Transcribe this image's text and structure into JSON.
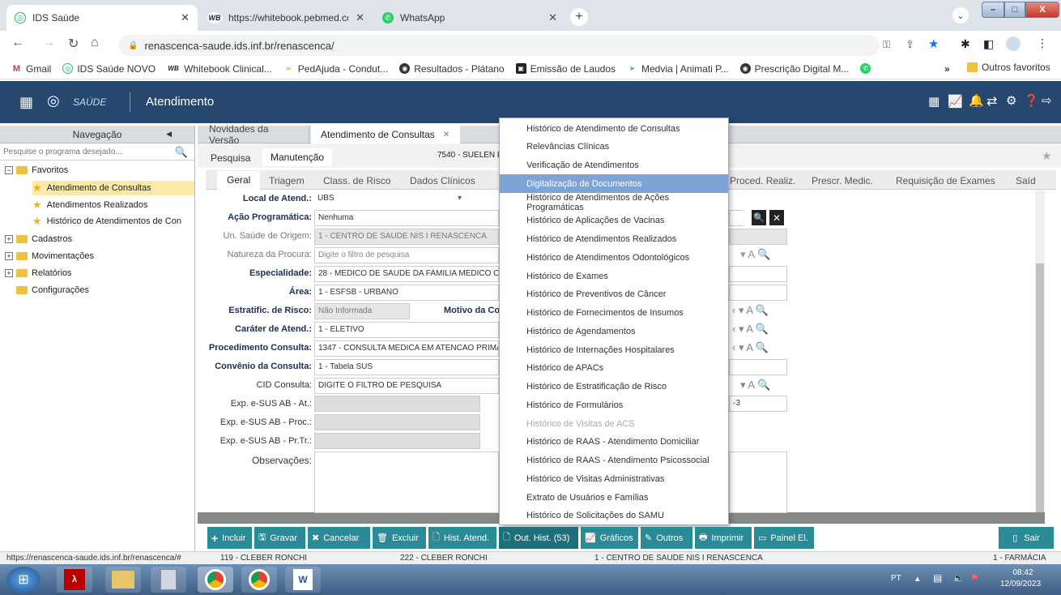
{
  "browser": {
    "tabs": [
      {
        "title": "IDS Saúde",
        "active": true
      },
      {
        "title": "https://whitebook.pebmed.com.b",
        "active": false
      },
      {
        "title": "WhatsApp",
        "active": false
      }
    ],
    "url": "renascenca-saude.ids.inf.br/renascenca/",
    "bookmarks": [
      "Gmail",
      "IDS Saúde NOVO",
      "Whitebook Clinical...",
      "PedAjuda - Condut...",
      "Resultados - Plátano",
      "Emissão de Laudos",
      "Medvia | Animati P...",
      "Prescrição Digital M..."
    ],
    "bookmarks_more": "»",
    "other_bookmarks": "Outros favoritos"
  },
  "app": {
    "logo_text": "SAÚDE",
    "module_title": "Atendimento"
  },
  "nav": {
    "header": "Navegação",
    "search_placeholder": "Pesquise o programa desejado...",
    "favorites": "Favoritos",
    "fav_items": [
      "Atendimento de Consultas",
      "Atendimentos Realizados",
      "Histórico de Atendimentos de Con"
    ],
    "groups": [
      "Cadastros",
      "Movimentações",
      "Relatórios",
      "Configurações"
    ]
  },
  "main": {
    "tabs": [
      "Novidades da Versão",
      "Atendimento de Consultas"
    ],
    "subtabs": [
      "Pesquisa",
      "Manutenção"
    ],
    "patient": "7540 - SUELEN E",
    "form_tabs_left": [
      "Geral",
      "Triagem",
      "Class. de Risco",
      "Dados Clínicos"
    ],
    "form_tabs_right": [
      "Proced. Realiz.",
      "Prescr. Medic.",
      "Requisição de Exames",
      "Saíd"
    ],
    "fields": {
      "local_label": "Local de Atend.:",
      "local_value": "UBS",
      "acao_label": "Ação Programática:",
      "acao_value": "Nenhuma",
      "un_label": "Un. Saúde de Origem:",
      "un_value": "1 - CENTRO DE SAUDE NIS I RENASCENCA",
      "natureza_label": "Natureza da Procura:",
      "natureza_value": "Digite o filtro de pesquisa",
      "espec_label": "Especialidade:",
      "espec_value": "28 - MEDICO DE SAUDE DA FAMILIA  MEDICO CO",
      "area_label": "Área:",
      "area_value": "1 - ESFSB - URBANO",
      "estrat_label": "Estratific. de Risco:",
      "estrat_value": "Não Informada",
      "motivo_label": "Motivo da Co",
      "carater_label": "Caráter de Atend.:",
      "carater_value": "1 - ELETIVO",
      "proc_label": "Procedimento Consulta:",
      "proc_value": "1347 - CONSULTA MEDICA EM ATENCAO PRIMA",
      "conv_label": "Convênio da Consulta:",
      "conv_value": "1 - Tabela SUS",
      "cid_label": "CID Consulta:",
      "cid_value": "DIGITE O FILTRO DE PESQUISA",
      "exp1_label": "Exp. e-SUS AB - At.:",
      "exp2_label": "Exp. e-SUS AB - Proc.:",
      "exp3_label": "Exp. e-SUS AB - Pr.Tr.:",
      "obs_label": "Observações:",
      "side_value": "-3"
    }
  },
  "dropdown": {
    "items": [
      "Histórico de Atendimento de Consultas",
      "Relevâncias Clínicas",
      "Verificação de Atendimentos",
      "Digitalização de Documentos",
      "Histórico de Atendimentos de Ações Programáticas",
      "Histórico de Aplicações de Vacinas",
      "Histórico de Atendimentos Realizados",
      "Histórico de Atendimentos Odontológicos",
      "Histórico de Exames",
      "Histórico de Preventivos de Câncer",
      "Histórico de Fornecimentos de Insumos",
      "Histórico de Agendamentos",
      "Histórico de Internações Hospitalares",
      "Histórico de APACs",
      "Histórico de Estratificação de Risco",
      "Histórico de Formulários",
      "Histórico de Visitas de ACS",
      "Histórico de RAAS - Atendimento Domiciliar",
      "Histórico de RAAS - Atendimento Psicossocial",
      "Histórico de Visitas Administrativas",
      "Extrato de Usuários e Famílias",
      "Histórico de Solicitações do SAMU"
    ],
    "selected_index": 3,
    "disabled_index": 16
  },
  "toolbar": {
    "incluir": "Incluir",
    "gravar": "Gravar",
    "cancelar": "Cancelar",
    "excluir": "Excluir",
    "hist": "Hist. Atend.",
    "out": "Out. Hist. (53)",
    "graficos": "Gráficos",
    "outros": "Outros",
    "imprimir": "Imprimir",
    "painel": "Painel El.",
    "sair": "Sair"
  },
  "statusbar": {
    "url": "https://renascenca-saude.ids.inf.br/renascenca/#",
    "s1": "119 - CLEBER RONCHI",
    "s2": "222 - CLEBER RONCHI",
    "s3": "1 - CENTRO DE SAUDE NIS I RENASCENCA",
    "s4": "1 - FARMÁCIA"
  },
  "taskbar": {
    "lang": "PT",
    "time": "08:42",
    "date": "12/09/2023"
  },
  "colors": {
    "header": "#26476e",
    "toolbar": "#2a8a96",
    "selected": "#7ea4d7"
  }
}
